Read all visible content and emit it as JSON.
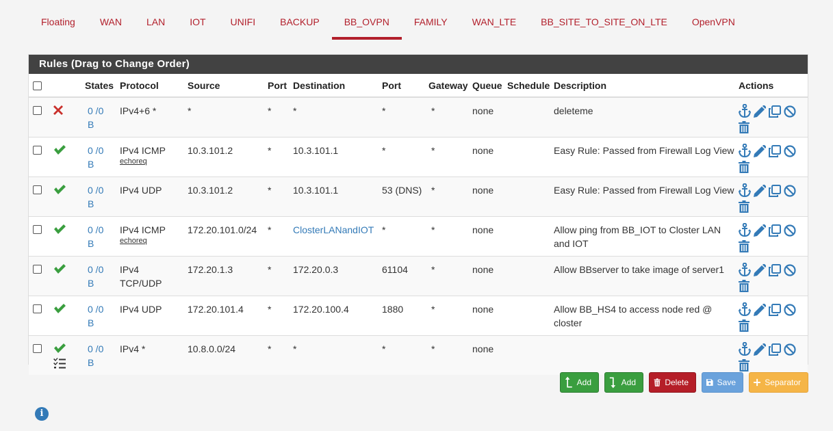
{
  "tabs": [
    {
      "label": "Floating"
    },
    {
      "label": "WAN"
    },
    {
      "label": "LAN"
    },
    {
      "label": "IOT"
    },
    {
      "label": "UNIFI"
    },
    {
      "label": "BACKUP"
    },
    {
      "label": "BB_OVPN",
      "active": true
    },
    {
      "label": "FAMILY"
    },
    {
      "label": "WAN_LTE"
    },
    {
      "label": "BB_SITE_TO_SITE_ON_LTE"
    },
    {
      "label": "OpenVPN"
    }
  ],
  "panel": {
    "title": "Rules (Drag to Change Order)"
  },
  "columns": {
    "states": "States",
    "protocol": "Protocol",
    "source": "Source",
    "port": "Port",
    "destination": "Destination",
    "dport": "Port",
    "gateway": "Gateway",
    "queue": "Queue",
    "schedule": "Schedule",
    "description": "Description",
    "actions": "Actions"
  },
  "rules": [
    {
      "status": "block",
      "states_a": "0 /0",
      "states_b": "B",
      "protocol": "IPv4+6 *",
      "proto_sub": "",
      "source": "*",
      "sport": "*",
      "destination": "*",
      "dest_link": false,
      "dport": "*",
      "gateway": "*",
      "queue": "none",
      "schedule": "",
      "description": "deleteme"
    },
    {
      "status": "pass",
      "states_a": "0 /0",
      "states_b": "B",
      "protocol": "IPv4 ICMP",
      "proto_sub": "echoreq",
      "source": "10.3.101.2",
      "sport": "*",
      "destination": "10.3.101.1",
      "dest_link": false,
      "dport": "*",
      "gateway": "*",
      "queue": "none",
      "schedule": "",
      "description": "Easy Rule: Passed from Firewall Log View"
    },
    {
      "status": "pass",
      "states_a": "0 /0",
      "states_b": "B",
      "protocol": "IPv4 UDP",
      "proto_sub": "",
      "source": "10.3.101.2",
      "sport": "*",
      "destination": "10.3.101.1",
      "dest_link": false,
      "dport": "53 (DNS)",
      "gateway": "*",
      "queue": "none",
      "schedule": "",
      "description": "Easy Rule: Passed from Firewall Log View"
    },
    {
      "status": "pass",
      "states_a": "0 /0",
      "states_b": "B",
      "protocol": "IPv4 ICMP",
      "proto_sub": "echoreq",
      "source": "172.20.101.0/24",
      "sport": "*",
      "destination": "ClosterLANandIOT",
      "dest_link": true,
      "dport": "*",
      "gateway": "*",
      "queue": "none",
      "schedule": "",
      "description": "Allow ping from BB_IOT to Closter LAN and IOT"
    },
    {
      "status": "pass",
      "states_a": "0 /0",
      "states_b": "B",
      "protocol": "IPv4 TCP/UDP",
      "proto_sub": "",
      "source": "172.20.1.3",
      "sport": "*",
      "destination": "172.20.0.3",
      "dest_link": false,
      "dport": "61104",
      "gateway": "*",
      "queue": "none",
      "schedule": "",
      "description": "Allow BBserver to take image of server1"
    },
    {
      "status": "pass",
      "states_a": "0 /0",
      "states_b": "B",
      "protocol": "IPv4 UDP",
      "proto_sub": "",
      "source": "172.20.101.4",
      "sport": "*",
      "destination": "172.20.100.4",
      "dest_link": false,
      "dport": "1880",
      "gateway": "*",
      "queue": "none",
      "schedule": "",
      "description": "Allow BB_HS4 to access node red @ closter"
    },
    {
      "status": "pass-list",
      "states_a": "0 /0",
      "states_b": "B",
      "protocol": "IPv4 *",
      "proto_sub": "",
      "source": "10.8.0.0/24",
      "sport": "*",
      "destination": "*",
      "dest_link": false,
      "dport": "*",
      "gateway": "*",
      "queue": "none",
      "schedule": "",
      "description": ""
    }
  ],
  "buttons": {
    "add_top": "Add",
    "add_bottom": "Add",
    "delete": "Delete",
    "save": "Save",
    "separator": "Separator"
  },
  "colors": {
    "accent": "#b21f2b",
    "link": "#337ab7",
    "pass": "#3a9e3f",
    "block": "#c9302c",
    "header": "#424242"
  },
  "icons": {
    "info": "i"
  }
}
